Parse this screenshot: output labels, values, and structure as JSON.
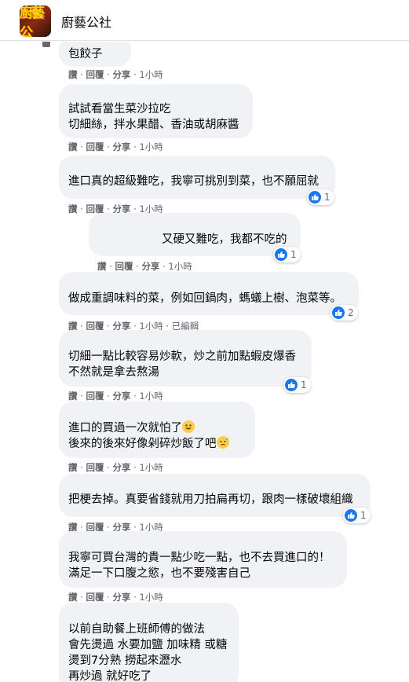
{
  "header": {
    "group_name": "廚藝公社",
    "avatar_text": "廚藝公"
  },
  "comments": [
    {
      "lines": [
        "包餃子"
      ],
      "meta": [
        "讚",
        "回覆",
        "分享",
        "1小時"
      ]
    },
    {
      "lines": [
        "試試看當生菜沙拉吃",
        "切細絲，拌水果醋、香油或胡麻醬"
      ],
      "meta": [
        "讚",
        "回覆",
        "分享",
        "1小時"
      ]
    },
    {
      "lines": [
        "進口真的超級難吃，我寧可挑別到菜，也不願屈就"
      ],
      "meta": [
        "讚",
        "回覆",
        "分享",
        "1小時"
      ],
      "reactions": "1"
    },
    {
      "lines": [
        "又硬又難吃，我都不吃的"
      ],
      "meta": [
        "讚",
        "回覆",
        "分享",
        "1小時"
      ],
      "reactions": "1"
    },
    {
      "lines": [
        "做成重調味料的菜，例如回鍋肉，螞蟻上樹、泡菜等。"
      ],
      "meta": [
        "讚",
        "回覆",
        "分享",
        "1小時",
        "已編輯"
      ],
      "reactions": "2"
    },
    {
      "lines": [
        "切細一點比較容易炒軟，炒之前加點蝦皮爆香",
        "不然就是拿去熬湯"
      ],
      "meta": [
        "讚",
        "回覆",
        "分享",
        "1小時"
      ],
      "reactions": "1"
    },
    {
      "lines": [
        "進口的買過一次就怕了",
        "後來的後來好像剁碎炒飯了吧"
      ],
      "meta": [
        "讚",
        "回覆",
        "分享",
        "1小時"
      ]
    },
    {
      "lines": [
        "把梗去掉。真要省錢就用刀拍扁再切，跟肉一樣破壞組織"
      ],
      "meta": [
        "讚",
        "回覆",
        "分享",
        "1小時"
      ],
      "reactions": "1"
    },
    {
      "lines": [
        "我寧可買台灣的貴一點少吃一點，也不去買進口的！",
        "滿足一下口腹之慾，也不要殘害自己"
      ],
      "meta": [
        "讚",
        "回覆",
        "分享",
        "1小時"
      ]
    },
    {
      "lines": [
        "以前自助餐上班師傅的做法",
        "會先燙過 水要加鹽 加味精 或糖",
        "燙到7分熟 撈起來瀝水",
        "再炒過 就好吃了"
      ]
    }
  ],
  "colors": {
    "bubble": "#f0f2f5",
    "meta_text": "#65676b",
    "like_blue": "#1877f2",
    "text": "#050505"
  },
  "icons": {
    "like": "like-thumb-icon",
    "emoji_smile": "grinning-face-emoji",
    "emoji_sweat": "sweat-face-emoji"
  }
}
